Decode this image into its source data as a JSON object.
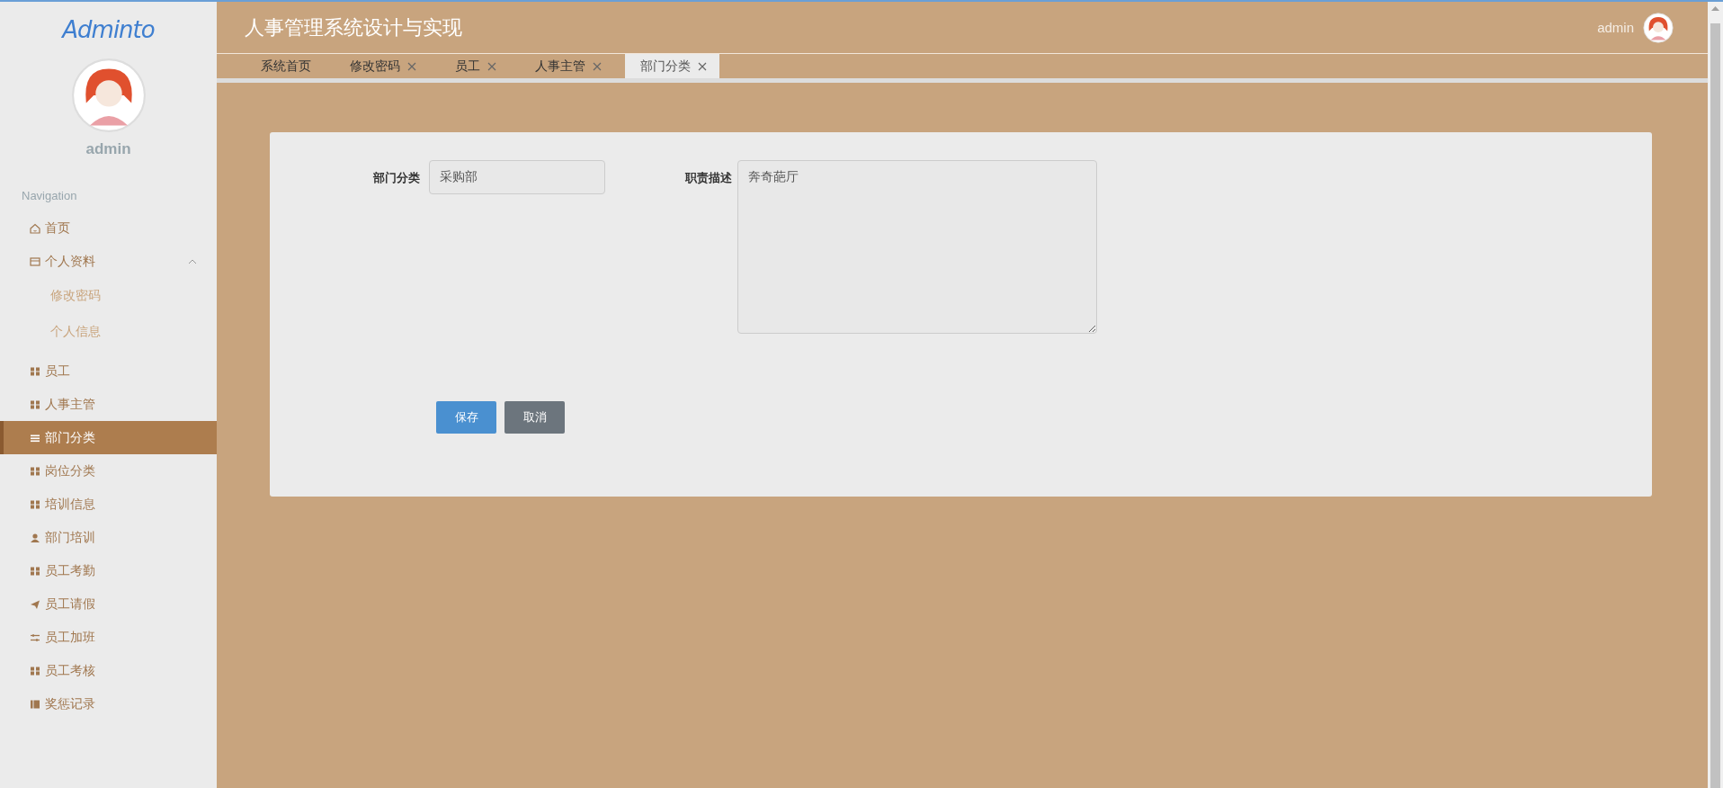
{
  "sidebar": {
    "logo": "Adminto",
    "user_name": "admin",
    "nav_heading": "Navigation",
    "items": [
      {
        "label": "首页",
        "kind": "item",
        "selected": false
      },
      {
        "label": "个人资料",
        "kind": "group",
        "selected": false,
        "expanded": true,
        "children": [
          {
            "label": "修改密码",
            "selected": false
          },
          {
            "label": "个人信息",
            "selected": false
          }
        ]
      },
      {
        "label": "员工",
        "kind": "item",
        "selected": false
      },
      {
        "label": "人事主管",
        "kind": "item",
        "selected": false
      },
      {
        "label": "部门分类",
        "kind": "item",
        "selected": true
      },
      {
        "label": "岗位分类",
        "kind": "item",
        "selected": false
      },
      {
        "label": "培训信息",
        "kind": "item",
        "selected": false
      },
      {
        "label": "部门培训",
        "kind": "item",
        "selected": false
      },
      {
        "label": "员工考勤",
        "kind": "item",
        "selected": false
      },
      {
        "label": "员工请假",
        "kind": "item",
        "selected": false
      },
      {
        "label": "员工加班",
        "kind": "item",
        "selected": false
      },
      {
        "label": "员工考核",
        "kind": "item",
        "selected": false
      },
      {
        "label": "奖惩记录",
        "kind": "item",
        "selected": false
      }
    ]
  },
  "header": {
    "title": "人事管理系统设计与实现",
    "user_name": "admin"
  },
  "tabs": [
    {
      "label": "系统首页",
      "selected": false,
      "closable": false
    },
    {
      "label": "修改密码",
      "selected": false,
      "closable": true
    },
    {
      "label": "员工",
      "selected": false,
      "closable": true
    },
    {
      "label": "人事主管",
      "selected": false,
      "closable": true
    },
    {
      "label": "部门分类",
      "selected": true,
      "closable": true
    }
  ],
  "form": {
    "fields": [
      {
        "label": "部门分类",
        "kind": "input",
        "value": "采购部"
      },
      {
        "label": "职责描述",
        "kind": "textarea",
        "value": "奔奇葩厅"
      }
    ],
    "buttons": [
      {
        "label": "保存",
        "kind": "primary"
      },
      {
        "label": "取消",
        "kind": "secondary"
      }
    ]
  }
}
